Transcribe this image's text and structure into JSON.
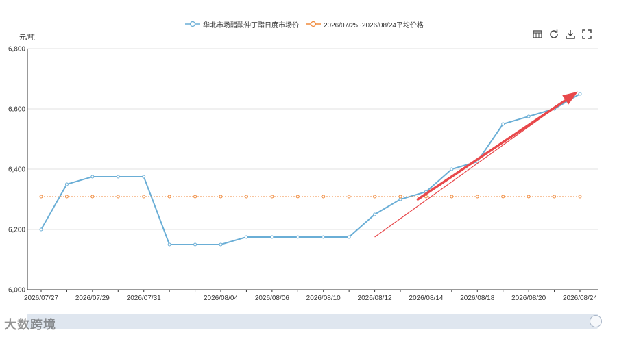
{
  "legend": {
    "series1": "华北市场醋酸仲丁酯日度市场价",
    "series2": "2026/07/25~2026/08/24平均价格"
  },
  "toolbar": [
    "data-view-icon",
    "refresh-icon",
    "download-icon",
    "fullscreen-icon"
  ],
  "unit_label": "元/吨",
  "watermark": "大数跨境",
  "colors": {
    "series1": "#6aaed6",
    "series2": "#f08a3c",
    "arrow": "#e8484b",
    "axis": "#333333",
    "grid": "#e2e2e2"
  },
  "chart_data": {
    "type": "line",
    "x": [
      "2026/07/27",
      "2026/07/28",
      "2026/07/29",
      "2026/07/30",
      "2026/07/31",
      "2026/08/01",
      "2026/08/03",
      "2026/08/04",
      "2026/08/05",
      "2026/08/06",
      "2026/08/07",
      "2026/08/10",
      "2026/08/11",
      "2026/08/12",
      "2026/08/13",
      "2026/08/14",
      "2026/08/17",
      "2026/08/18",
      "2026/08/19",
      "2026/08/20",
      "2026/08/21",
      "2026/08/24"
    ],
    "x_tick_labels": [
      "2026/07/27",
      "2026/07/29",
      "2026/07/31",
      "2026/08/04",
      "2026/08/06",
      "2026/08/10",
      "2026/08/12",
      "2026/08/14",
      "2026/08/18",
      "2026/08/20",
      "2026/08/24"
    ],
    "series": [
      {
        "name": "华北市场醋酸仲丁酯日度市场价",
        "values": [
          6200,
          6350,
          6375,
          6375,
          6375,
          6150,
          6150,
          6150,
          6175,
          6175,
          6175,
          6175,
          6175,
          6250,
          6300,
          6325,
          6400,
          6425,
          6550,
          6575,
          6600,
          6650
        ]
      },
      {
        "name": "2026/07/25~2026/08/24平均价格",
        "values": [
          6309,
          6309,
          6309,
          6309,
          6309,
          6309,
          6309,
          6309,
          6309,
          6309,
          6309,
          6309,
          6309,
          6309,
          6309,
          6309,
          6309,
          6309,
          6309,
          6309,
          6309,
          6309
        ]
      }
    ],
    "ylim": [
      6000,
      6800
    ],
    "yticks": [
      6000,
      6200,
      6400,
      6600,
      6800
    ],
    "ytick_labels": [
      "6,000",
      "6,200",
      "6,400",
      "6,600",
      "6,800"
    ],
    "grid": true,
    "legend_position": "top-center"
  }
}
